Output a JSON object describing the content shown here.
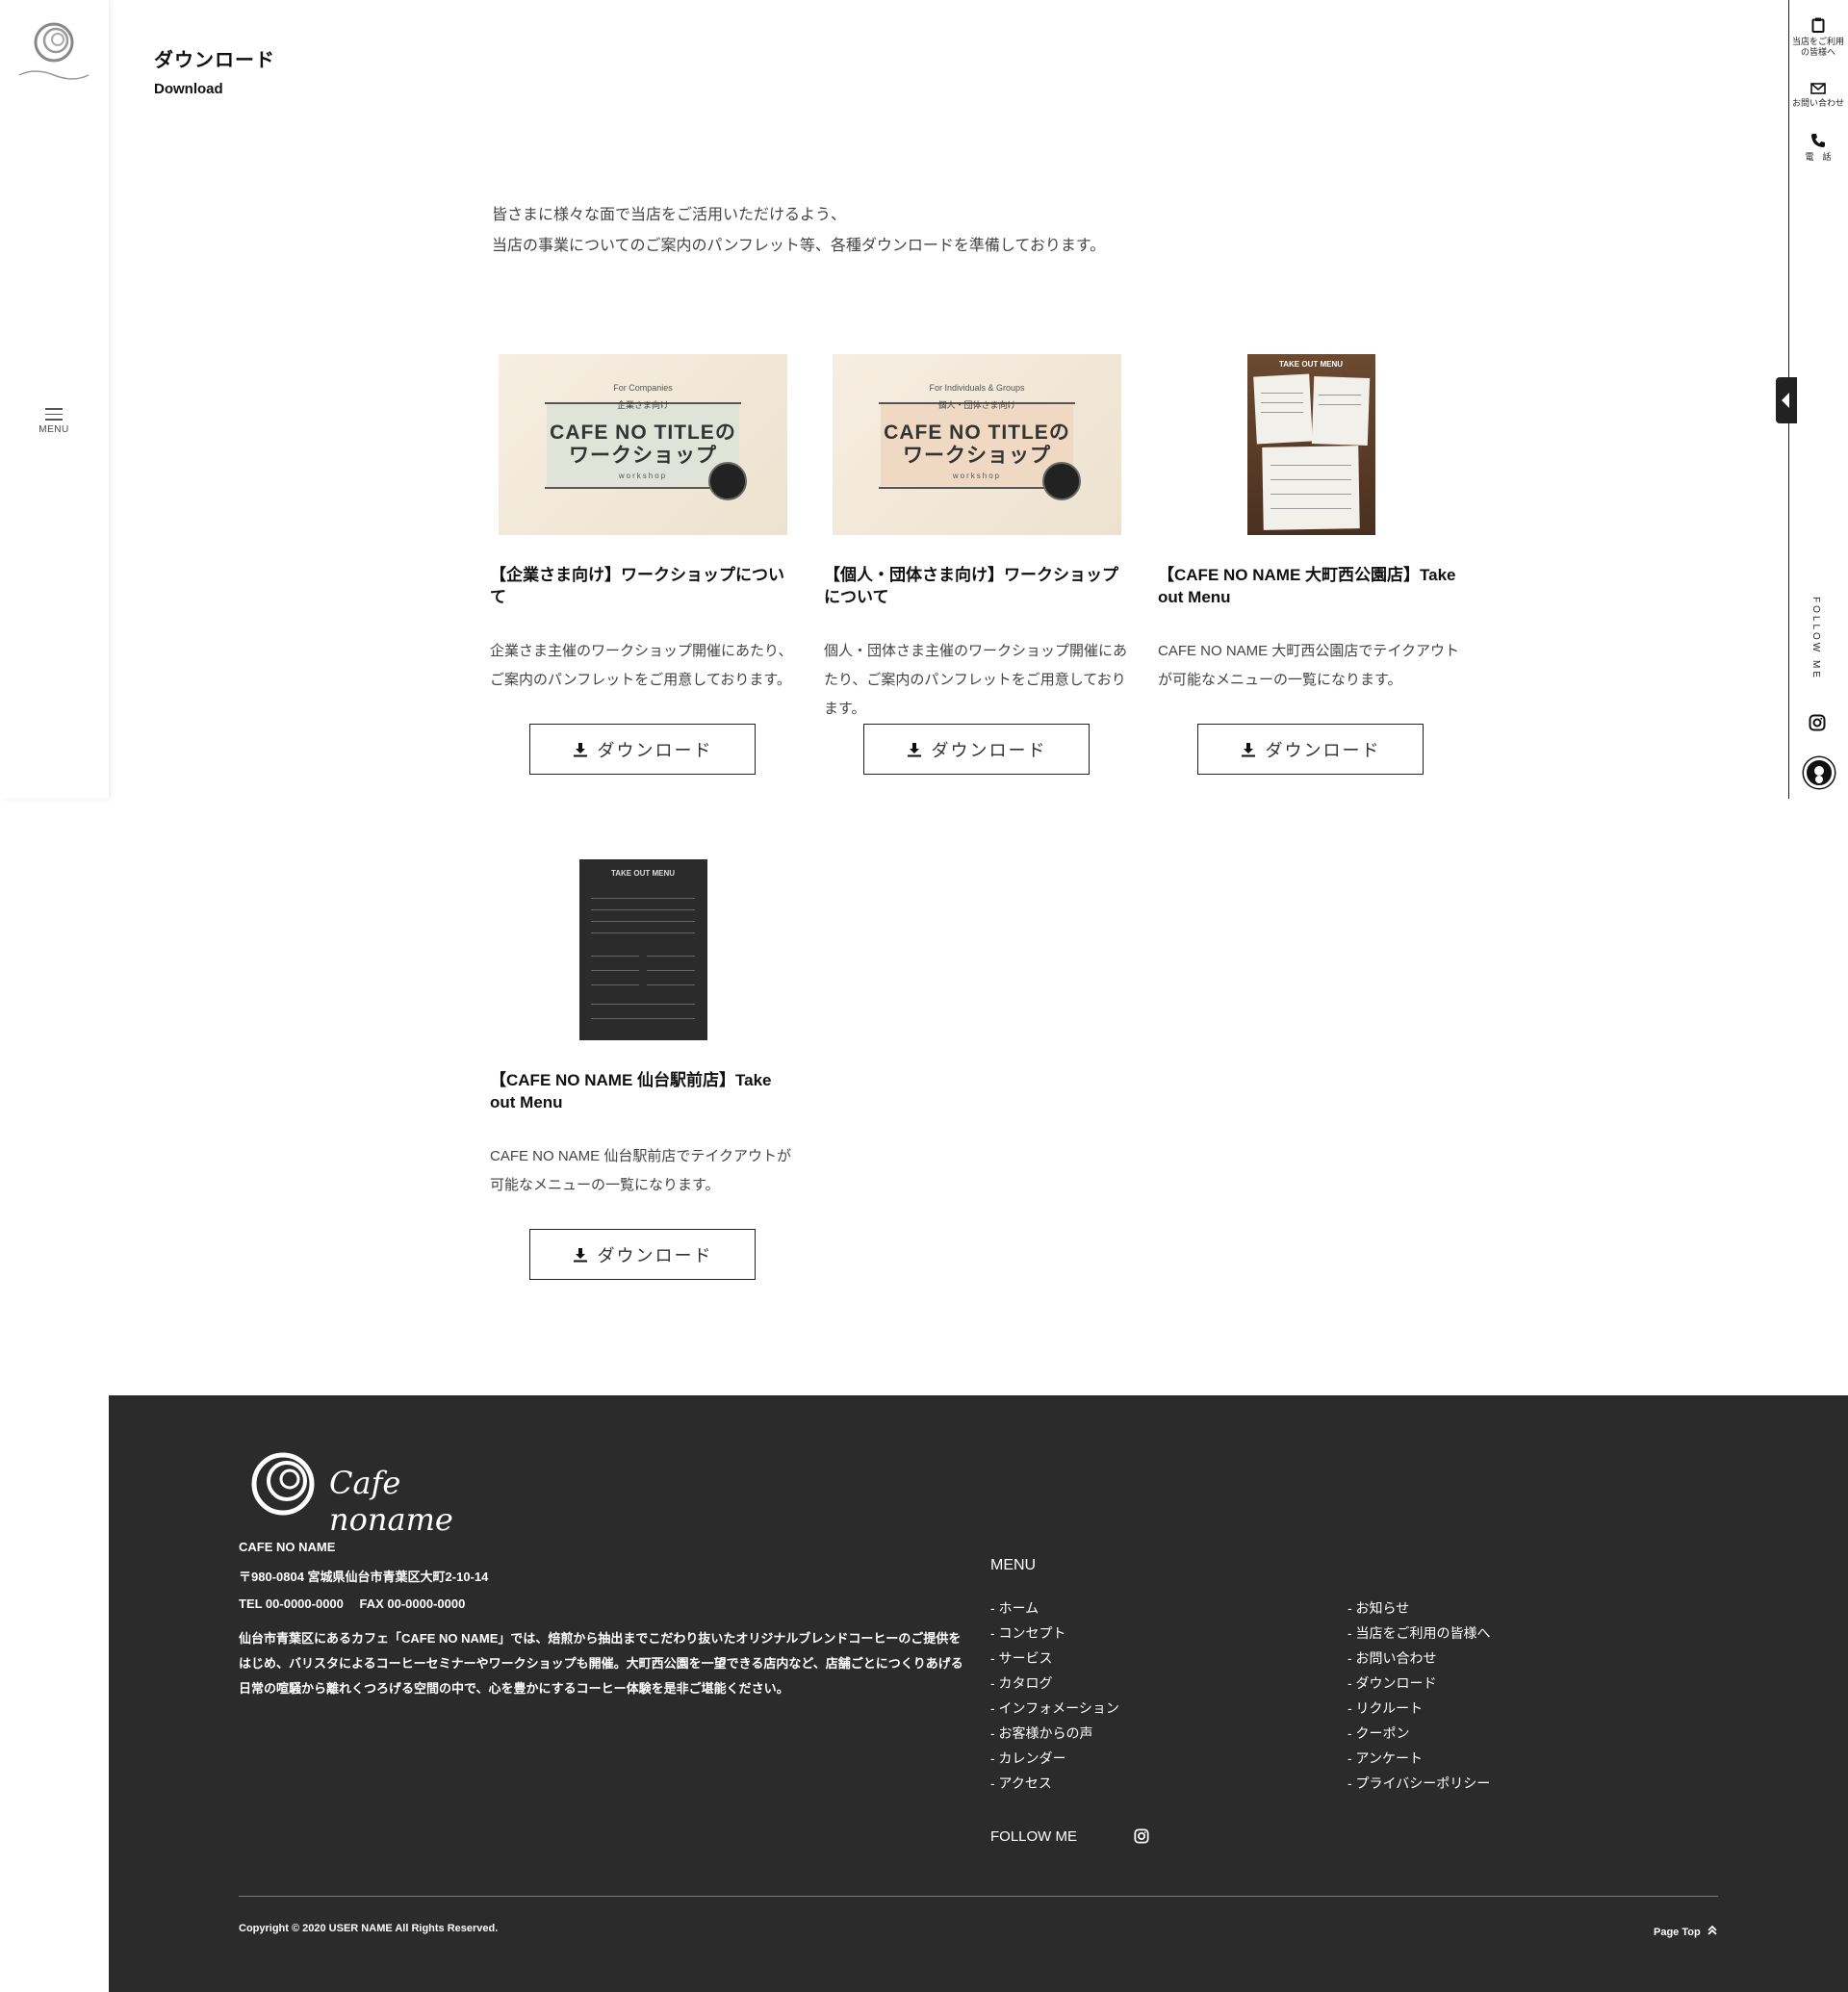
{
  "brand": {
    "logo_text": "Cafe noname"
  },
  "sidebar": {
    "menu_label": "MENU"
  },
  "right_bar": {
    "items": [
      {
        "label": "当店をご利用の皆様へ",
        "icon": "clipboard-icon"
      },
      {
        "label": "お問い合わせ",
        "icon": "mail-icon"
      },
      {
        "label": "電　話",
        "icon": "phone-icon"
      }
    ],
    "follow_label": "FOLLOW ME"
  },
  "page": {
    "title": "ダウンロード",
    "subtitle": "Download",
    "intro_line1": "皆さまに様々な面で当店をご活用いただけるよう、",
    "intro_line2": "当店の事業についてのご案内のパンフレット等、各種ダウンロードを準備しております。"
  },
  "downloads": [
    {
      "title": "【企業さま向け】ワークショップについて",
      "desc": "企業さま主催のワークショップ開催にあたり、ご案内のパンフレットをご用意しております。",
      "button": "ダウンロード",
      "thumb": {
        "sub": "For Companies",
        "jp": "企業さま向け",
        "main1": "CAFE NO TITLEの",
        "main2": "ワークショップ",
        "foot": "workshop",
        "band_color": "#dfe3d8"
      }
    },
    {
      "title": "【個人・団体さま向け】ワークショップについて",
      "desc": "個人・団体さま主催のワークショップ開催にあたり、ご案内のパンフレットをご用意しております。",
      "button": "ダウンロード",
      "thumb": {
        "sub": "For Individuals & Groups",
        "jp": "個人・団体さま向け",
        "main1": "CAFE NO TITLEの",
        "main2": "ワークショップ",
        "foot": "workshop",
        "band_color": "#f0d9c2"
      }
    },
    {
      "title": "【CAFE NO NAME 大町西公園店】Take out Menu",
      "desc": "CAFE NO NAME 大町西公園店でテイクアウトが可能なメニューの一覧になります。",
      "button": "ダウンロード",
      "thumb": {
        "heading": "TAKE OUT MENU"
      }
    },
    {
      "title": "【CAFE NO NAME 仙台駅前店】Take out Menu",
      "desc": "CAFE NO NAME 仙台駅前店でテイクアウトが可能なメニューの一覧になります。",
      "button": "ダウンロード",
      "thumb": {
        "heading": "TAKE OUT MENU"
      }
    }
  ],
  "footer": {
    "shop_name": "CAFE NO NAME",
    "address": "〒980-0804  宮城県仙台市青葉区大町2-10-14",
    "tel_fax": "TEL 00-0000-0000　 FAX 00-0000-0000",
    "description": "仙台市青葉区にあるカフェ「CAFE NO NAME」では、焙煎から抽出までこだわり抜いたオリジナルブレンドコーヒーのご提供をはじめ、バリスタによるコーヒーセミナーやワークショップも開催。大町西公園を一望できる店内など、店舗ごとにつくりあげる日常の喧騒から離れくつろげる空間の中で、心を豊かにするコーヒー体験を是非ご堪能ください。",
    "menu_title": "MENU",
    "menu_col1": [
      "- ホーム",
      "- コンセプト",
      "- サービス",
      "- カタログ",
      "- インフォメーション",
      "- お客様からの声",
      "- カレンダー",
      "- アクセス"
    ],
    "menu_col2": [
      "- お知らせ",
      "- 当店をご利用の皆様へ",
      "- お問い合わせ",
      "- ダウンロード",
      "- リクルート",
      "- クーポン",
      "- アンケート",
      "- プライバシーポリシー"
    ],
    "follow_label": "FOLLOW ME",
    "copyright": "Copyright © 2020 USER NAME All Rights Reserved.",
    "page_top": "Page Top"
  },
  "colors": {
    "footer_bg": "#2b2b2b",
    "text": "#222222",
    "accent": "#111111"
  }
}
